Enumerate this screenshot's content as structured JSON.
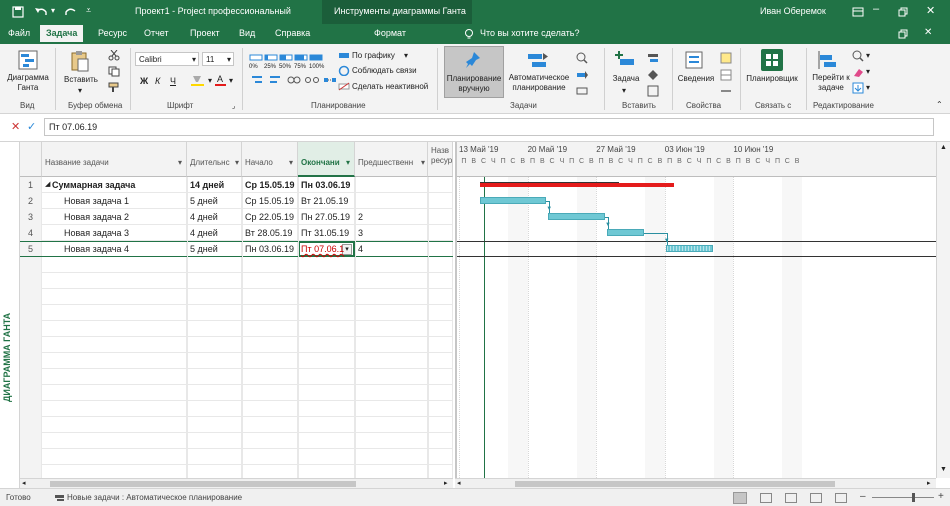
{
  "titlebar": {
    "title": "Проект1 - Project профессиональный",
    "context_tab": "Инструменты диаграммы Ганта",
    "user": "Иван Оберемок"
  },
  "tabs": [
    "Файл",
    "Задача",
    "Ресурс",
    "Отчет",
    "Проект",
    "Вид",
    "Справка"
  ],
  "active_tab": "Задача",
  "format_tab": "Формат",
  "tell_me": "Что вы хотите сделать?",
  "ribbon": {
    "gantt_chart_label": "Диаграмма Ганта",
    "group_view": "Вид",
    "paste_label": "Вставить",
    "group_clipboard": "Буфер обмена",
    "font_name": "Calibri",
    "font_size": "11",
    "bold": "Ж",
    "italic": "К",
    "underline": "Ч",
    "group_font": "Шрифт",
    "pct_labels": [
      "0%",
      "25%",
      "50%",
      "75%",
      "100%"
    ],
    "on_schedule": "По графику",
    "respect_links": "Соблюдать связи",
    "inactivate": "Сделать неактивной",
    "group_schedule": "Планирование",
    "manual_label": "Планирование вручную",
    "auto_label": "Автоматическое планирование",
    "group_tasks": "Задачи",
    "task_label": "Задача",
    "group_insert": "Вставить",
    "info_label": "Сведения",
    "group_properties": "Свойства",
    "planner_label": "Планировщик",
    "group_connect": "Связать с",
    "goto_label": "Перейти к задаче",
    "group_editing": "Редактирование"
  },
  "formula": {
    "value": "Пт 07.06.19"
  },
  "columns": {
    "name": "Название задачи",
    "duration": "Длительнс",
    "start": "Начало",
    "finish": "Окончани",
    "predecessors": "Предшественн",
    "resources": "Назв ресур"
  },
  "rows": [
    {
      "num": "1",
      "name": "Суммарная задача",
      "duration": "14 дней",
      "start": "Ср 15.05.19",
      "finish": "Пн 03.06.19",
      "pred": "",
      "summary": true
    },
    {
      "num": "2",
      "name": "Новая задача 1",
      "duration": "5 дней",
      "start": "Ср 15.05.19",
      "finish": "Вт 21.05.19",
      "pred": "",
      "summary": false
    },
    {
      "num": "3",
      "name": "Новая задача 2",
      "duration": "4 дней",
      "start": "Ср 22.05.19",
      "finish": "Пн 27.05.19",
      "pred": "2",
      "summary": false
    },
    {
      "num": "4",
      "name": "Новая задача 3",
      "duration": "4 дней",
      "start": "Вт 28.05.19",
      "finish": "Пт 31.05.19",
      "pred": "3",
      "summary": false
    },
    {
      "num": "5",
      "name": "Новая задача 4",
      "duration": "5 дней",
      "start": "Пн 03.06.19",
      "finish": "Пт 07.06.1",
      "pred": "4",
      "summary": false
    }
  ],
  "empty_row_count": 16,
  "timescale": {
    "weeks": [
      "13 Май '19",
      "20 Май '19",
      "27 Май '19",
      "03 Июн '19",
      "10 Июн '19"
    ],
    "day_letters": [
      "П",
      "В",
      "С",
      "Ч",
      "П",
      "С",
      "В"
    ]
  },
  "sidebar_label": "ДИАГРАММА ГАНТА",
  "status": {
    "ready": "Готово",
    "mode": "Новые задачи : Автоматическое планирование"
  },
  "colors": {
    "accent": "#217346",
    "task_bar": "#6fc8d4",
    "summary_bar": "#e41b1b"
  }
}
